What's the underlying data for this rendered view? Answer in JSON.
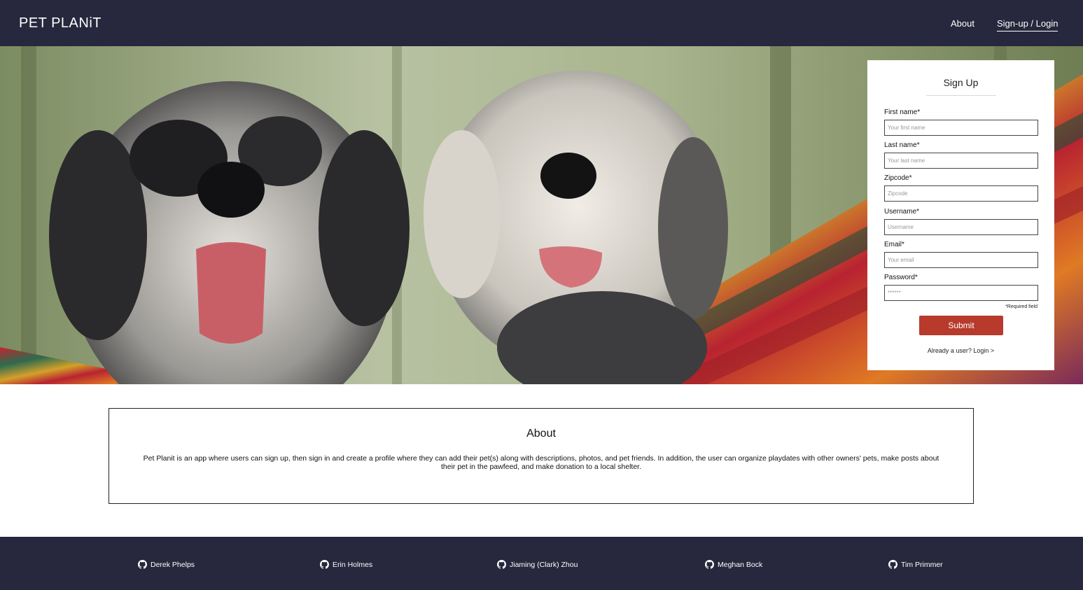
{
  "navbar": {
    "brand": "PET PLANiT",
    "links": [
      "About",
      "Sign-up / Login"
    ]
  },
  "hero": {
    "image": "two shaggy dogs in a hammock"
  },
  "signup": {
    "title": "Sign Up",
    "fields": [
      {
        "label": "First name*",
        "placeholder": "Your first name"
      },
      {
        "label": "Last name*",
        "placeholder": "Your last name"
      },
      {
        "label": "Zipcode*",
        "placeholder": "Zipcode"
      },
      {
        "label": "Username*",
        "placeholder": "Username"
      },
      {
        "label": "Email*",
        "placeholder": "Your email"
      },
      {
        "label": "Password*",
        "placeholder": "******"
      }
    ],
    "required_note": "*Required field",
    "submit_label": "Submit",
    "login_link": "Already a user? Login >"
  },
  "about": {
    "title": "About",
    "text": "Pet Planit is an app where users can sign up, then sign in and create a profile where they can add their pet(s) along with descriptions, photos, and pet friends. In addition, the user can organize playdates with other owners' pets, make posts about their pet in the pawfeed, and make donation to a local shelter."
  },
  "footer": {
    "icon": "github-icon",
    "contributors": [
      "Derek Phelps",
      "Erin Holmes",
      "Jiaming (Clark) Zhou",
      "Meghan Bock",
      "Tim Primmer"
    ]
  },
  "colors": {
    "nav_bg": "#27273d",
    "submit_bg": "#b73a2c"
  }
}
